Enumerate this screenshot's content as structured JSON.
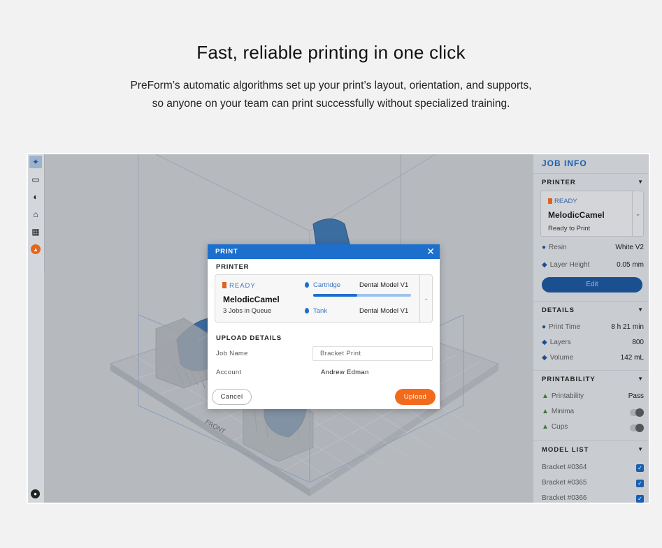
{
  "hero": {
    "title": "Fast, reliable printing in one click",
    "subtitle_line1": "PreForm’s automatic algorithms set up your print’s layout, orientation, and supports,",
    "subtitle_line2": "so anyone on your team can print successfully without specialized training."
  },
  "toolbar": {
    "items": [
      {
        "icon": "magic-wand-icon",
        "active": true
      },
      {
        "icon": "layout-icon"
      },
      {
        "icon": "orientation-icon"
      },
      {
        "icon": "supports-icon"
      },
      {
        "icon": "grid-icon"
      },
      {
        "icon": "printer-badge-icon"
      }
    ]
  },
  "viewport": {
    "front_label": "FRONT"
  },
  "dialog": {
    "title": "PRINT",
    "close": "✕",
    "printer_section": "PRINTER",
    "printer": {
      "status": "READY",
      "name": "MelodicCamel",
      "queue": "3 Jobs in Queue",
      "cartridge_label": "Cartridge",
      "cartridge_material": "Dental Model V1",
      "cartridge_level": 0.45,
      "tank_label": "Tank",
      "tank_material": "Dental Model V1"
    },
    "upload_section": "UPLOAD DETAILS",
    "job_name_label": "Job Name",
    "job_name_placeholder": "Bracket Print",
    "account_label": "Account",
    "account_value": "Andrew Edman",
    "cancel_label": "Cancel",
    "upload_label": "Upload"
  },
  "side": {
    "title": "JOB INFO",
    "printer_head": "PRINTER",
    "printer_status": "READY",
    "printer_name": "MelodicCamel",
    "printer_ready": "Ready to Print",
    "resin_label": "Resin",
    "resin_value": "White V2",
    "layer_label": "Layer Height",
    "layer_value": "0.05 mm",
    "edit_label": "Edit",
    "details_head": "DETAILS",
    "print_time_label": "Print Time",
    "print_time_value": "8 h 21 min",
    "layers_label": "Layers",
    "layers_value": "800",
    "volume_label": "Volume",
    "volume_value": "142 mL",
    "printability_head": "PRINTABILITY",
    "printability_label": "Printability",
    "printability_value": "Pass",
    "minima_label": "Minima",
    "cups_label": "Cups",
    "model_list_head": "MODEL LIST",
    "models": [
      "Bracket #0364",
      "Bracket #0365",
      "Bracket #0366"
    ]
  },
  "colors": {
    "accent": "#1c6fcc",
    "upload": "#f26a1b",
    "ready_badge": "#e0621c"
  }
}
